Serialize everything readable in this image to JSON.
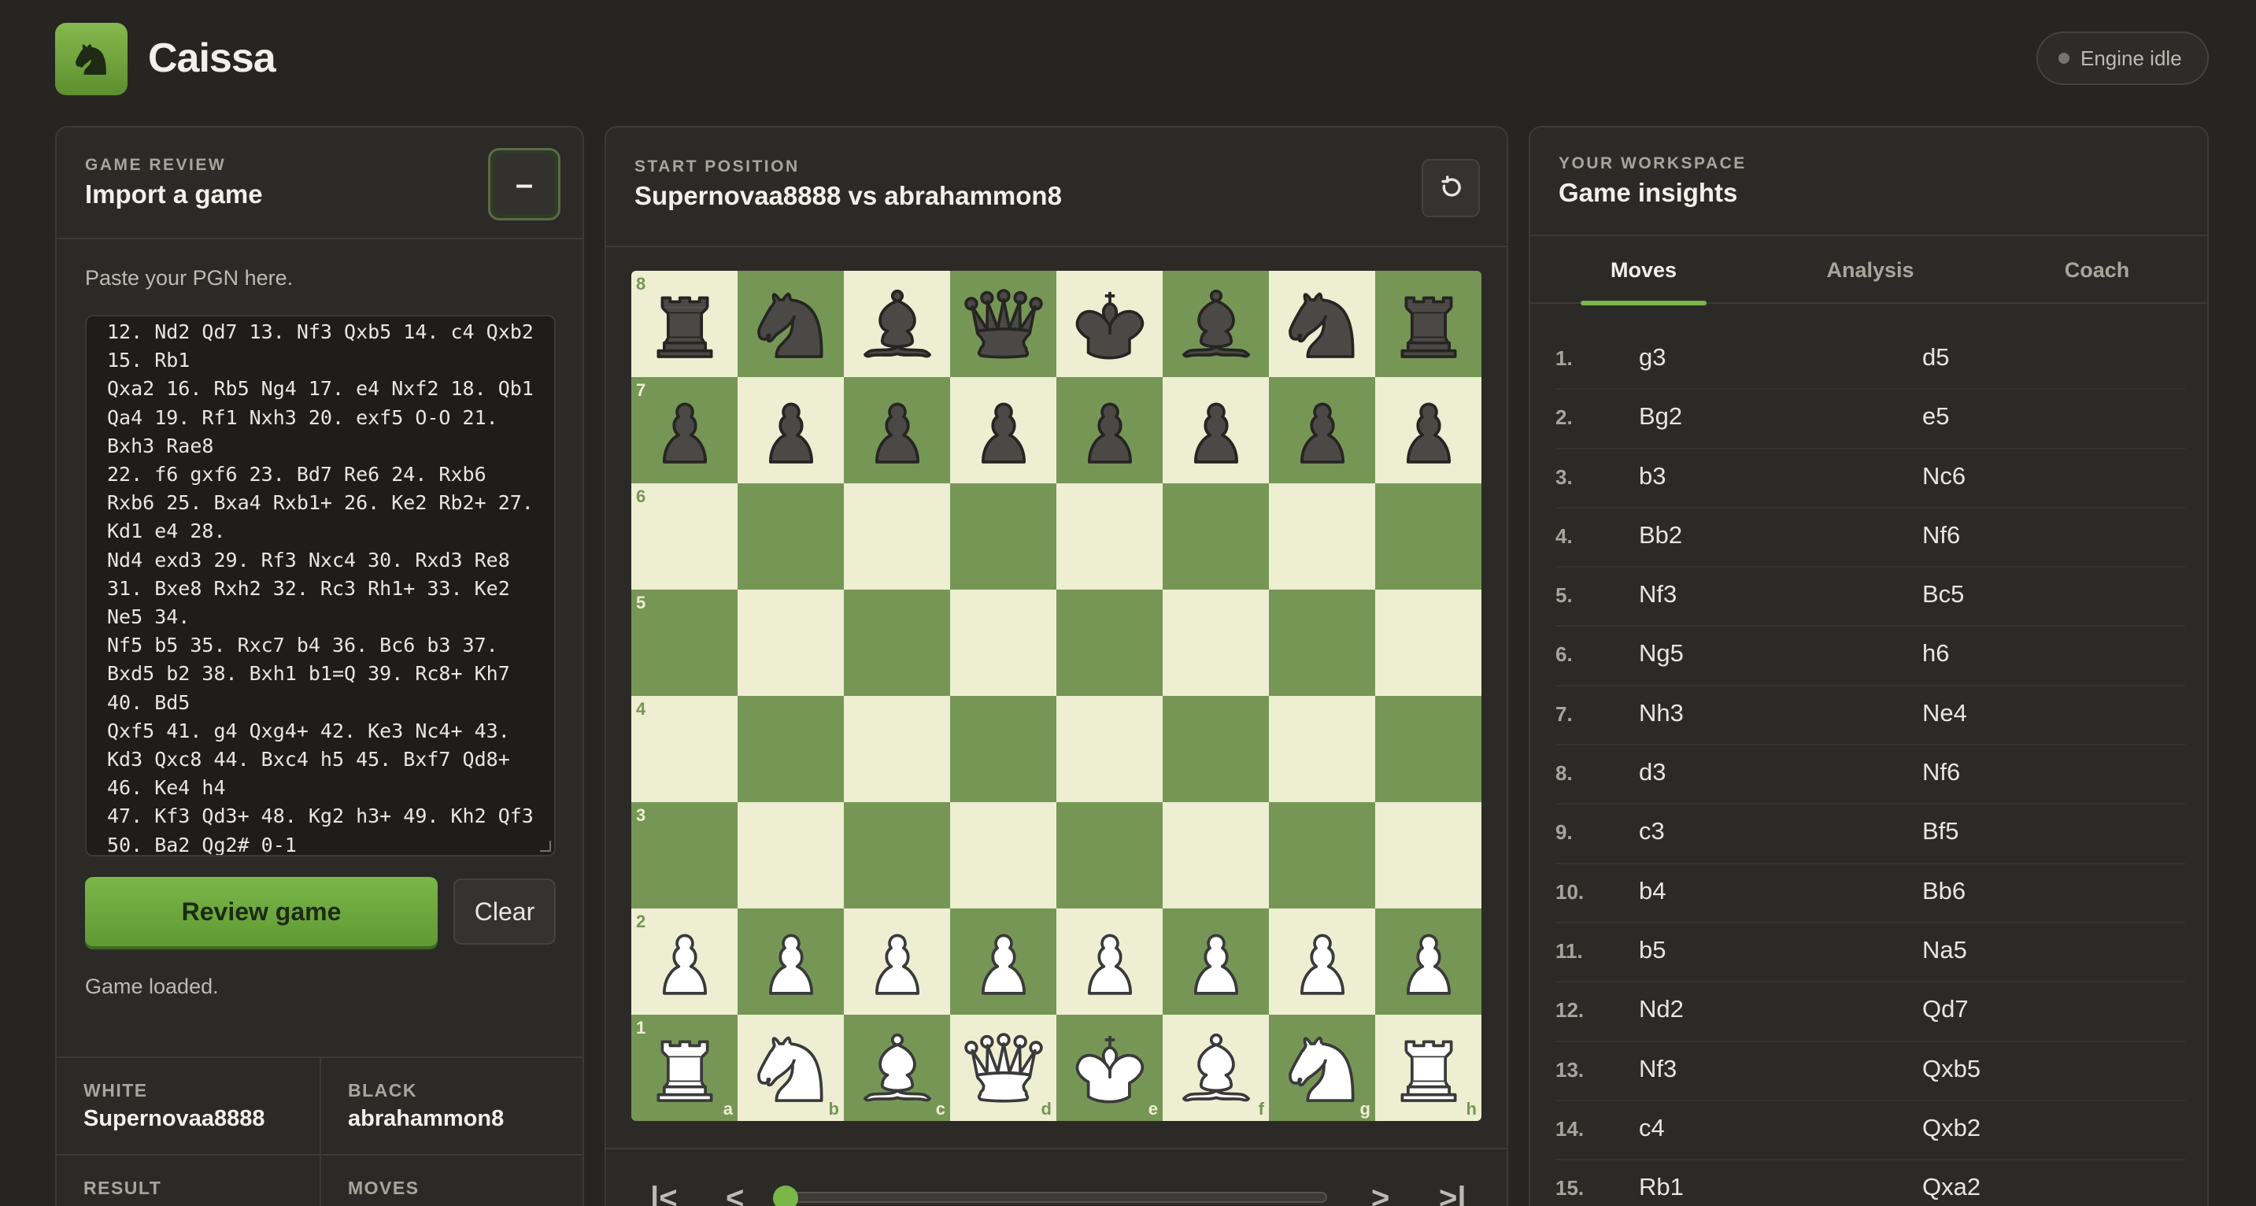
{
  "app": {
    "name": "Caissa",
    "engine_status": "Engine idle"
  },
  "left_panel": {
    "eyebrow": "GAME REVIEW",
    "title": "Import a game",
    "collapse_label": "–",
    "paste_label": "Paste your PGN here.",
    "pgn_text": "12. Nd2 Qd7 13. Nf3 Qxb5 14. c4 Qxb2\n15. Rb1\nQxa2 16. Rb5 Ng4 17. e4 Nxf2 18. Qb1\nQa4 19. Rf1 Nxh3 20. exf5 O-O 21.\nBxh3 Rae8\n22. f6 gxf6 23. Bd7 Re6 24. Rxb6\nRxb6 25. Bxa4 Rxb1+ 26. Ke2 Rb2+ 27.\nKd1 e4 28.\nNd4 exd3 29. Rf3 Nxc4 30. Rxd3 Re8\n31. Bxe8 Rxh2 32. Rc3 Rh1+ 33. Ke2\nNe5 34.\nNf5 b5 35. Rxc7 b4 36. Bc6 b3 37.\nBxd5 b2 38. Bxh1 b1=Q 39. Rc8+ Kh7\n40. Bd5\nQxf5 41. g4 Qxg4+ 42. Ke3 Nc4+ 43.\nKd3 Qxc8 44. Bxc4 h5 45. Bxf7 Qd8+\n46. Ke4 h4\n47. Kf3 Qd3+ 48. Kg2 h3+ 49. Kh2 Qf3\n50. Ba2 Qg2# 0-1",
    "review_button": "Review game",
    "clear_button": "Clear",
    "status": "Game loaded.",
    "meta": {
      "white_label": "WHITE",
      "white_value": "Supernovaa8888",
      "black_label": "BLACK",
      "black_value": "abrahammon8",
      "result_label": "RESULT",
      "moves_label": "MOVES"
    }
  },
  "center_panel": {
    "eyebrow": "START POSITION",
    "title": "Supernovaa8888 vs abrahammon8",
    "board": {
      "ranks": [
        "8",
        "7",
        "6",
        "5",
        "4",
        "3",
        "2",
        "1"
      ],
      "files": [
        "a",
        "b",
        "c",
        "d",
        "e",
        "f",
        "g",
        "h"
      ],
      "position": [
        "rnbqkbnr",
        "pppppppp",
        "........",
        "........",
        "........",
        "........",
        "PPPPPPPP",
        "RNBQKBNR"
      ]
    },
    "nav": {
      "first": "|<",
      "prev": "<",
      "next": ">",
      "last": ">|",
      "slider_position": 0
    }
  },
  "right_panel": {
    "eyebrow": "YOUR WORKSPACE",
    "title": "Game insights",
    "tabs": [
      "Moves",
      "Analysis",
      "Coach"
    ],
    "active_tab": "Moves",
    "moves": [
      {
        "n": "1.",
        "w": "g3",
        "b": "d5"
      },
      {
        "n": "2.",
        "w": "Bg2",
        "b": "e5"
      },
      {
        "n": "3.",
        "w": "b3",
        "b": "Nc6"
      },
      {
        "n": "4.",
        "w": "Bb2",
        "b": "Nf6"
      },
      {
        "n": "5.",
        "w": "Nf3",
        "b": "Bc5"
      },
      {
        "n": "6.",
        "w": "Ng5",
        "b": "h6"
      },
      {
        "n": "7.",
        "w": "Nh3",
        "b": "Ne4"
      },
      {
        "n": "8.",
        "w": "d3",
        "b": "Nf6"
      },
      {
        "n": "9.",
        "w": "c3",
        "b": "Bf5"
      },
      {
        "n": "10.",
        "w": "b4",
        "b": "Bb6"
      },
      {
        "n": "11.",
        "w": "b5",
        "b": "Na5"
      },
      {
        "n": "12.",
        "w": "Nd2",
        "b": "Qd7"
      },
      {
        "n": "13.",
        "w": "Nf3",
        "b": "Qxb5"
      },
      {
        "n": "14.",
        "w": "c4",
        "b": "Qxb2"
      },
      {
        "n": "15.",
        "w": "Rb1",
        "b": "Qxa2"
      }
    ]
  },
  "colors": {
    "accent": "#7ab648",
    "board_light": "#eeeed2",
    "board_dark": "#769656"
  }
}
